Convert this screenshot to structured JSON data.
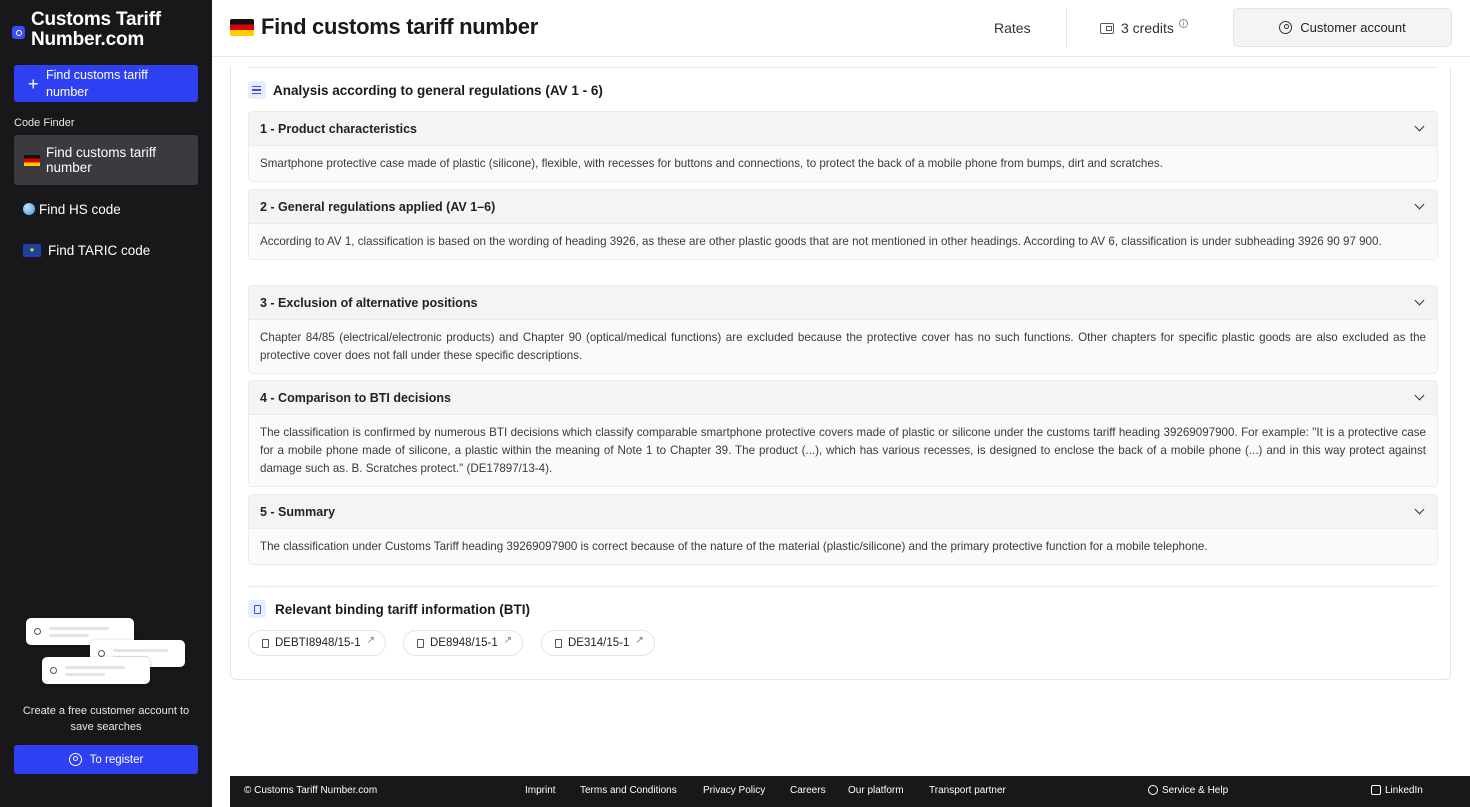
{
  "sidebar": {
    "brand": "Customs Tariff Number.com",
    "primary_button": "Find customs tariff number",
    "section_label": "Code Finder",
    "items": [
      {
        "label": "Find customs tariff number",
        "icon": "german-flag-icon",
        "active": true
      },
      {
        "label": "Find HS code",
        "icon": "globe-icon",
        "active": false
      },
      {
        "label": "Find TARIC code",
        "icon": "eu-flag-icon",
        "active": false
      }
    ],
    "cta_text": "Create a free customer account to save searches",
    "register_button": "To register"
  },
  "header": {
    "title": "Find customs tariff number",
    "rates": "Rates",
    "credits": "3 credits",
    "account_button": "Customer account"
  },
  "analysis": {
    "title": "Analysis according to general regulations (AV 1 - 6)",
    "sections": [
      {
        "title": "1 - Product characteristics",
        "body": "Smartphone protective case made of plastic (silicone), flexible, with recesses for buttons and connections, to protect the back of a mobile phone from bumps, dirt and scratches."
      },
      {
        "title": "2 - General regulations applied (AV 1–6)",
        "body": "According to AV 1, classification is based on the wording of heading 3926, as these are other plastic goods that are not mentioned in other headings. According to AV 6, classification is under subheading 3926 90 97 900."
      },
      {
        "title": "3 - Exclusion of alternative positions",
        "body": "Chapter 84/85 (electrical/electronic products) and Chapter 90 (optical/medical functions) are excluded because the protective cover has no such functions. Other chapters for specific plastic goods are also excluded as the protective cover does not fall under these specific descriptions."
      },
      {
        "title": "4 - Comparison to BTI decisions",
        "body": "The classification is confirmed by numerous BTI decisions which classify comparable smartphone protective covers made of plastic or silicone under the customs tariff heading 39269097900. For example: \"It is a protective case for a mobile phone made of silicone, a plastic within the meaning of Note 1 to Chapter 39. The product (...), which has various recesses, is designed to enclose the back of a mobile phone (...) and in this way protect against damage such as. B. Scratches protect.\" (DE17897/13-4)."
      },
      {
        "title": "5 - Summary",
        "body": "The classification under Customs Tariff heading 39269097900 is correct because of the nature of the material (plastic/silicone) and the primary protective function for a mobile telephone."
      }
    ]
  },
  "bti": {
    "title": "Relevant binding tariff information (BTI)",
    "chips": [
      "DEBTI8948/15-1",
      "DE8948/15-1",
      "DE314/15-1"
    ]
  },
  "footer": {
    "copyright": "© Customs Tariff Number.com",
    "links": [
      "Imprint",
      "Terms and Conditions",
      "Privacy Policy",
      "Careers",
      "Our platform",
      "Transport partner"
    ],
    "help": "Service & Help",
    "linkedin": "LinkedIn"
  },
  "colors": {
    "accent": "#2f3ff2",
    "sidebar_bg": "#18181b"
  }
}
